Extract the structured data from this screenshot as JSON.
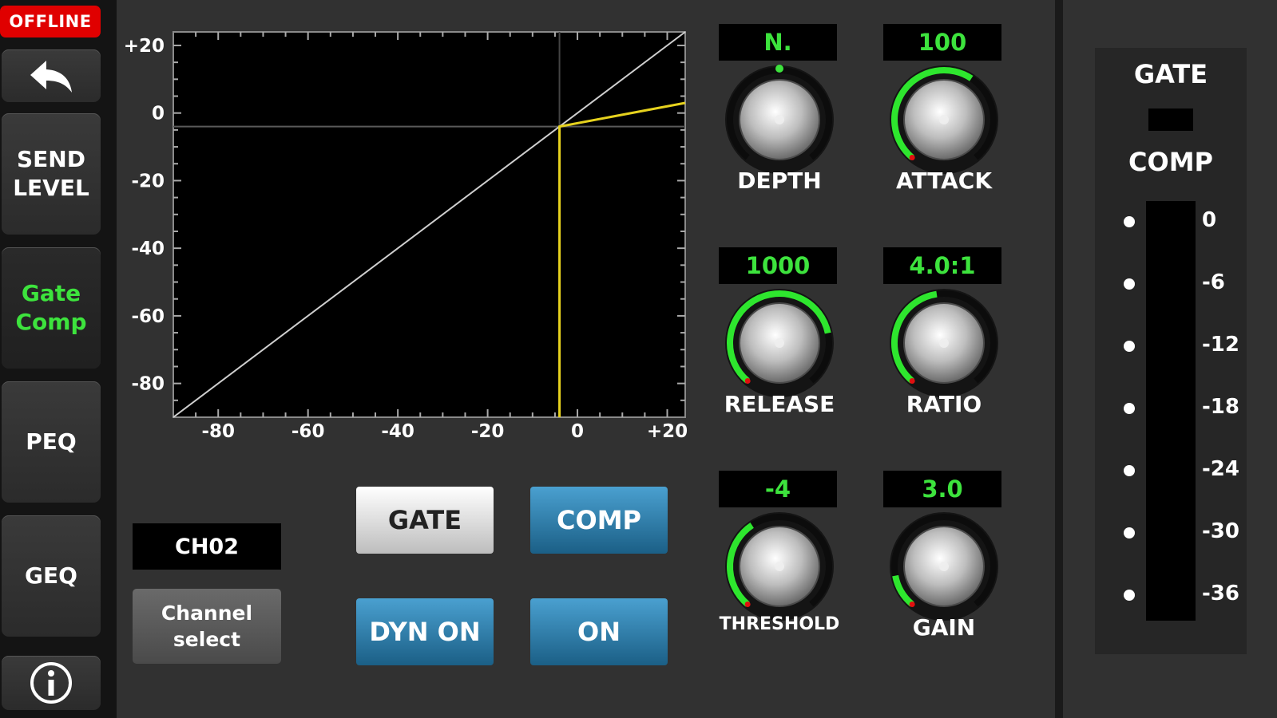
{
  "status": {
    "offline": "OFFLINE"
  },
  "sidebar": {
    "back_icon": "back-arrow-icon",
    "items": [
      {
        "label_line1": "SEND",
        "label_line2": "LEVEL"
      },
      {
        "label_line1": "Gate",
        "label_line2": "Comp",
        "active": true
      },
      {
        "label": "PEQ"
      },
      {
        "label": "GEQ"
      }
    ],
    "info_icon": "info-icon"
  },
  "graph": {
    "y_ticks": [
      "+20",
      "0",
      "-20",
      "-40",
      "-60",
      "-80"
    ],
    "x_ticks": [
      "-80",
      "-60",
      "-40",
      "-20",
      "0",
      "+20"
    ],
    "threshold_db": -4,
    "ratio": 4.0,
    "colors": {
      "curve": "#e6d21e",
      "unity": "#cfcfcf"
    }
  },
  "channel": {
    "name": "CH02",
    "select_line1": "Channel",
    "select_line2": "select"
  },
  "buttons": {
    "gate": "GATE",
    "comp": "COMP",
    "dyn_on": "DYN ON",
    "on": "ON"
  },
  "knobs": {
    "depth": {
      "value": "N.",
      "label": "DEPTH",
      "level": 0.5
    },
    "attack": {
      "value": "100",
      "label": "ATTACK",
      "level": 0.62
    },
    "release": {
      "value": "1000",
      "label": "RELEASE",
      "level": 0.78
    },
    "ratio": {
      "value": "4.0:1",
      "label": "RATIO",
      "level": 0.47
    },
    "threshold": {
      "value": "-4",
      "label": "THRESHOLD",
      "level": 0.38
    },
    "gain": {
      "value": "3.0",
      "label": "GAIN",
      "level": 0.14
    }
  },
  "meter": {
    "gate_label": "GATE",
    "comp_label": "COMP",
    "scale": [
      "0",
      "-6",
      "-12",
      "-18",
      "-24",
      "-30",
      "-36"
    ]
  },
  "accent": "#3de33d"
}
